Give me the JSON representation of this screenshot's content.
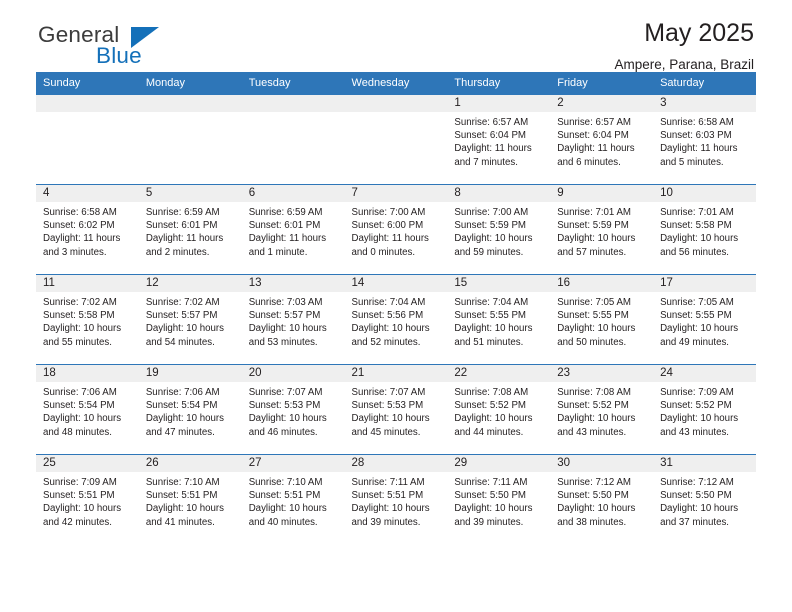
{
  "logo": {
    "word_top": "General",
    "word_bottom": "Blue",
    "accent_color": "#1470b9"
  },
  "header": {
    "title": "May 2025",
    "subtitle": "Ampere, Parana, Brazil"
  },
  "theme": {
    "header_blue": "#2e76b8",
    "daynum_band": "#efefef",
    "text": "#231f20"
  },
  "calendar": {
    "weekday_headers": [
      "Sunday",
      "Monday",
      "Tuesday",
      "Wednesday",
      "Thursday",
      "Friday",
      "Saturday"
    ],
    "labels": {
      "sunrise": "Sunrise:",
      "sunset": "Sunset:",
      "daylight": "Daylight:"
    },
    "weeks": [
      [
        {
          "day": "",
          "lines": []
        },
        {
          "day": "",
          "lines": []
        },
        {
          "day": "",
          "lines": []
        },
        {
          "day": "",
          "lines": []
        },
        {
          "day": "1",
          "lines": [
            "Sunrise: 6:57 AM",
            "Sunset: 6:04 PM",
            "Daylight: 11 hours and 7 minutes."
          ]
        },
        {
          "day": "2",
          "lines": [
            "Sunrise: 6:57 AM",
            "Sunset: 6:04 PM",
            "Daylight: 11 hours and 6 minutes."
          ]
        },
        {
          "day": "3",
          "lines": [
            "Sunrise: 6:58 AM",
            "Sunset: 6:03 PM",
            "Daylight: 11 hours and 5 minutes."
          ]
        }
      ],
      [
        {
          "day": "4",
          "lines": [
            "Sunrise: 6:58 AM",
            "Sunset: 6:02 PM",
            "Daylight: 11 hours and 3 minutes."
          ]
        },
        {
          "day": "5",
          "lines": [
            "Sunrise: 6:59 AM",
            "Sunset: 6:01 PM",
            "Daylight: 11 hours and 2 minutes."
          ]
        },
        {
          "day": "6",
          "lines": [
            "Sunrise: 6:59 AM",
            "Sunset: 6:01 PM",
            "Daylight: 11 hours and 1 minute."
          ]
        },
        {
          "day": "7",
          "lines": [
            "Sunrise: 7:00 AM",
            "Sunset: 6:00 PM",
            "Daylight: 11 hours and 0 minutes."
          ]
        },
        {
          "day": "8",
          "lines": [
            "Sunrise: 7:00 AM",
            "Sunset: 5:59 PM",
            "Daylight: 10 hours and 59 minutes."
          ]
        },
        {
          "day": "9",
          "lines": [
            "Sunrise: 7:01 AM",
            "Sunset: 5:59 PM",
            "Daylight: 10 hours and 57 minutes."
          ]
        },
        {
          "day": "10",
          "lines": [
            "Sunrise: 7:01 AM",
            "Sunset: 5:58 PM",
            "Daylight: 10 hours and 56 minutes."
          ]
        }
      ],
      [
        {
          "day": "11",
          "lines": [
            "Sunrise: 7:02 AM",
            "Sunset: 5:58 PM",
            "Daylight: 10 hours and 55 minutes."
          ]
        },
        {
          "day": "12",
          "lines": [
            "Sunrise: 7:02 AM",
            "Sunset: 5:57 PM",
            "Daylight: 10 hours and 54 minutes."
          ]
        },
        {
          "day": "13",
          "lines": [
            "Sunrise: 7:03 AM",
            "Sunset: 5:57 PM",
            "Daylight: 10 hours and 53 minutes."
          ]
        },
        {
          "day": "14",
          "lines": [
            "Sunrise: 7:04 AM",
            "Sunset: 5:56 PM",
            "Daylight: 10 hours and 52 minutes."
          ]
        },
        {
          "day": "15",
          "lines": [
            "Sunrise: 7:04 AM",
            "Sunset: 5:55 PM",
            "Daylight: 10 hours and 51 minutes."
          ]
        },
        {
          "day": "16",
          "lines": [
            "Sunrise: 7:05 AM",
            "Sunset: 5:55 PM",
            "Daylight: 10 hours and 50 minutes."
          ]
        },
        {
          "day": "17",
          "lines": [
            "Sunrise: 7:05 AM",
            "Sunset: 5:55 PM",
            "Daylight: 10 hours and 49 minutes."
          ]
        }
      ],
      [
        {
          "day": "18",
          "lines": [
            "Sunrise: 7:06 AM",
            "Sunset: 5:54 PM",
            "Daylight: 10 hours and 48 minutes."
          ]
        },
        {
          "day": "19",
          "lines": [
            "Sunrise: 7:06 AM",
            "Sunset: 5:54 PM",
            "Daylight: 10 hours and 47 minutes."
          ]
        },
        {
          "day": "20",
          "lines": [
            "Sunrise: 7:07 AM",
            "Sunset: 5:53 PM",
            "Daylight: 10 hours and 46 minutes."
          ]
        },
        {
          "day": "21",
          "lines": [
            "Sunrise: 7:07 AM",
            "Sunset: 5:53 PM",
            "Daylight: 10 hours and 45 minutes."
          ]
        },
        {
          "day": "22",
          "lines": [
            "Sunrise: 7:08 AM",
            "Sunset: 5:52 PM",
            "Daylight: 10 hours and 44 minutes."
          ]
        },
        {
          "day": "23",
          "lines": [
            "Sunrise: 7:08 AM",
            "Sunset: 5:52 PM",
            "Daylight: 10 hours and 43 minutes."
          ]
        },
        {
          "day": "24",
          "lines": [
            "Sunrise: 7:09 AM",
            "Sunset: 5:52 PM",
            "Daylight: 10 hours and 43 minutes."
          ]
        }
      ],
      [
        {
          "day": "25",
          "lines": [
            "Sunrise: 7:09 AM",
            "Sunset: 5:51 PM",
            "Daylight: 10 hours and 42 minutes."
          ]
        },
        {
          "day": "26",
          "lines": [
            "Sunrise: 7:10 AM",
            "Sunset: 5:51 PM",
            "Daylight: 10 hours and 41 minutes."
          ]
        },
        {
          "day": "27",
          "lines": [
            "Sunrise: 7:10 AM",
            "Sunset: 5:51 PM",
            "Daylight: 10 hours and 40 minutes."
          ]
        },
        {
          "day": "28",
          "lines": [
            "Sunrise: 7:11 AM",
            "Sunset: 5:51 PM",
            "Daylight: 10 hours and 39 minutes."
          ]
        },
        {
          "day": "29",
          "lines": [
            "Sunrise: 7:11 AM",
            "Sunset: 5:50 PM",
            "Daylight: 10 hours and 39 minutes."
          ]
        },
        {
          "day": "30",
          "lines": [
            "Sunrise: 7:12 AM",
            "Sunset: 5:50 PM",
            "Daylight: 10 hours and 38 minutes."
          ]
        },
        {
          "day": "31",
          "lines": [
            "Sunrise: 7:12 AM",
            "Sunset: 5:50 PM",
            "Daylight: 10 hours and 37 minutes."
          ]
        }
      ]
    ]
  }
}
